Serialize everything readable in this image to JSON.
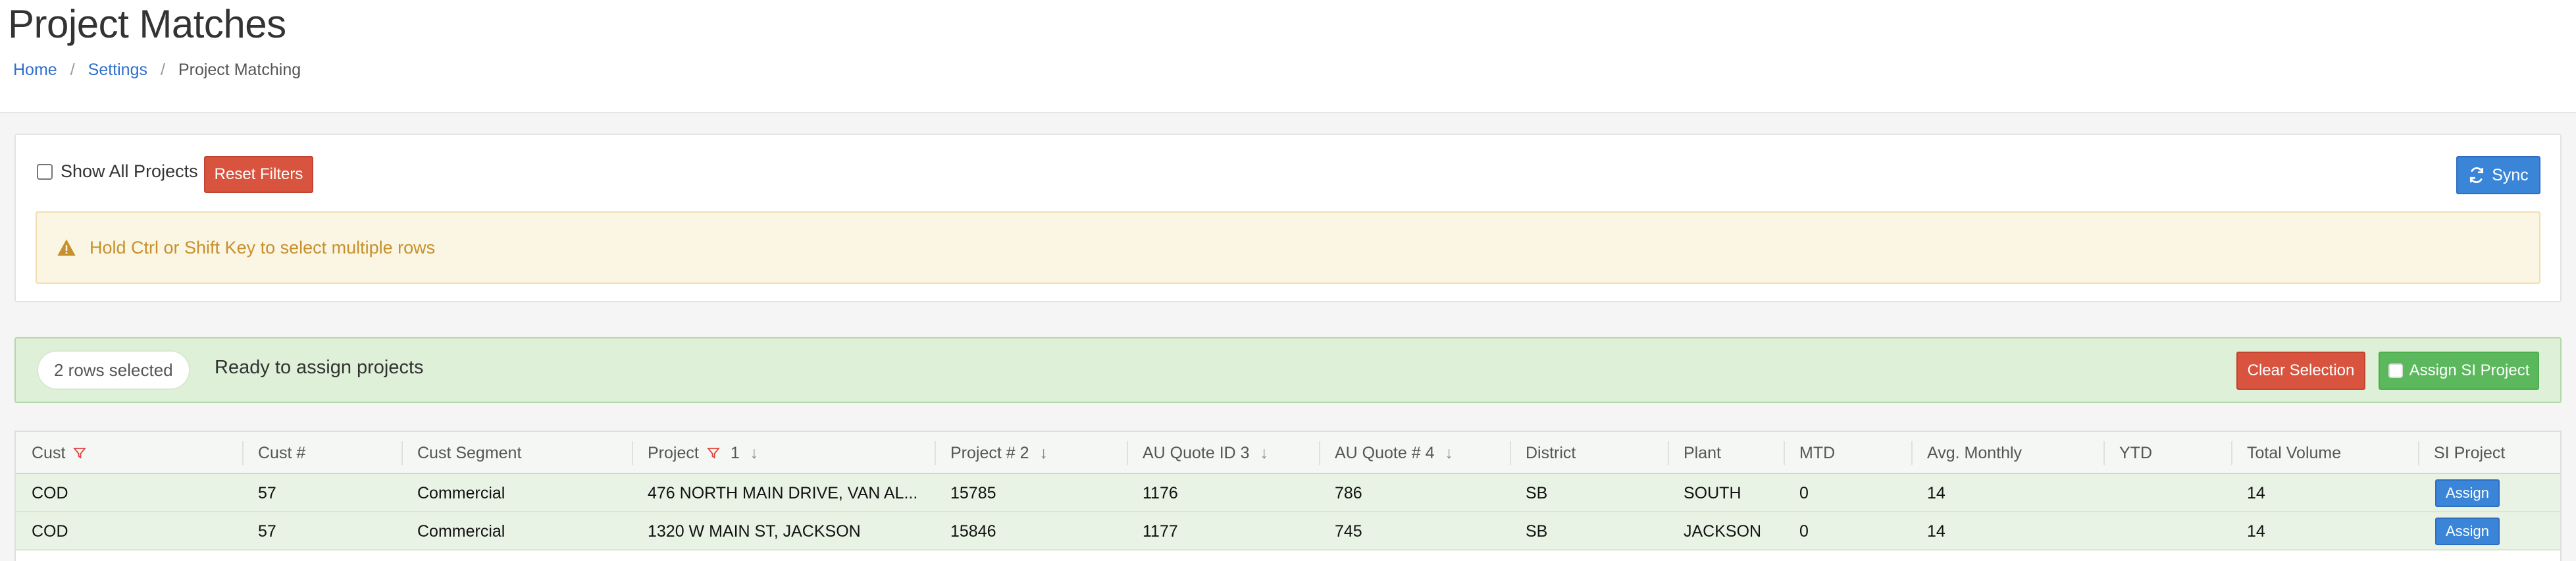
{
  "page": {
    "title": "Project Matches"
  },
  "breadcrumb": [
    {
      "label": "Home"
    },
    {
      "label": "Settings"
    },
    {
      "label": "Project Matching"
    }
  ],
  "filters": {
    "show_all_label": "Show All Projects",
    "show_all_checked": false,
    "reset_label": "Reset Filters",
    "sync_label": "Sync",
    "alert_text": "Hold Ctrl or Shift Key to select multiple rows"
  },
  "selection": {
    "count_label": "2 rows selected",
    "status_text": "Ready to assign projects",
    "clear_label": "Clear Selection",
    "assign_label": "Assign SI Project"
  },
  "table": {
    "columns": [
      {
        "label": "Cust",
        "filter": true
      },
      {
        "label": "Cust #"
      },
      {
        "label": "Cust Segment"
      },
      {
        "label": "Project",
        "filter": true,
        "sort_order": "1",
        "sort": "desc"
      },
      {
        "label": "Project # 2",
        "sort": "desc"
      },
      {
        "label": "AU Quote ID 3",
        "sort": "desc"
      },
      {
        "label": "AU Quote # 4",
        "sort": "desc"
      },
      {
        "label": "District"
      },
      {
        "label": "Plant"
      },
      {
        "label": "MTD"
      },
      {
        "label": "Avg. Monthly"
      },
      {
        "label": "YTD"
      },
      {
        "label": "Total Volume"
      },
      {
        "label": "SI Project"
      }
    ],
    "rows": [
      {
        "cust": "COD",
        "cust_num": "57",
        "segment": "Commercial",
        "project": "476 NORTH MAIN DRIVE, VAN AL...",
        "project_num": "15785",
        "au_quote_id": "1176",
        "au_quote_num": "786",
        "district": "SB",
        "plant": "SOUTH",
        "mtd": "0",
        "avg_monthly": "14",
        "ytd": "",
        "total_volume": "14",
        "action": "Assign"
      },
      {
        "cust": "COD",
        "cust_num": "57",
        "segment": "Commercial",
        "project": "1320 W MAIN ST, JACKSON",
        "project_num": "15846",
        "au_quote_id": "1177",
        "au_quote_num": "745",
        "district": "SB",
        "plant": "JACKSON",
        "mtd": "0",
        "avg_monthly": "14",
        "ytd": "",
        "total_volume": "14",
        "action": "Assign"
      }
    ]
  },
  "colors": {
    "link": "#2f6fd1",
    "danger": "#d9543f",
    "primary": "#3a85d8",
    "success": "#5cb85c",
    "warning_text": "#c7902b",
    "selected_row": "#e9f3e5"
  }
}
